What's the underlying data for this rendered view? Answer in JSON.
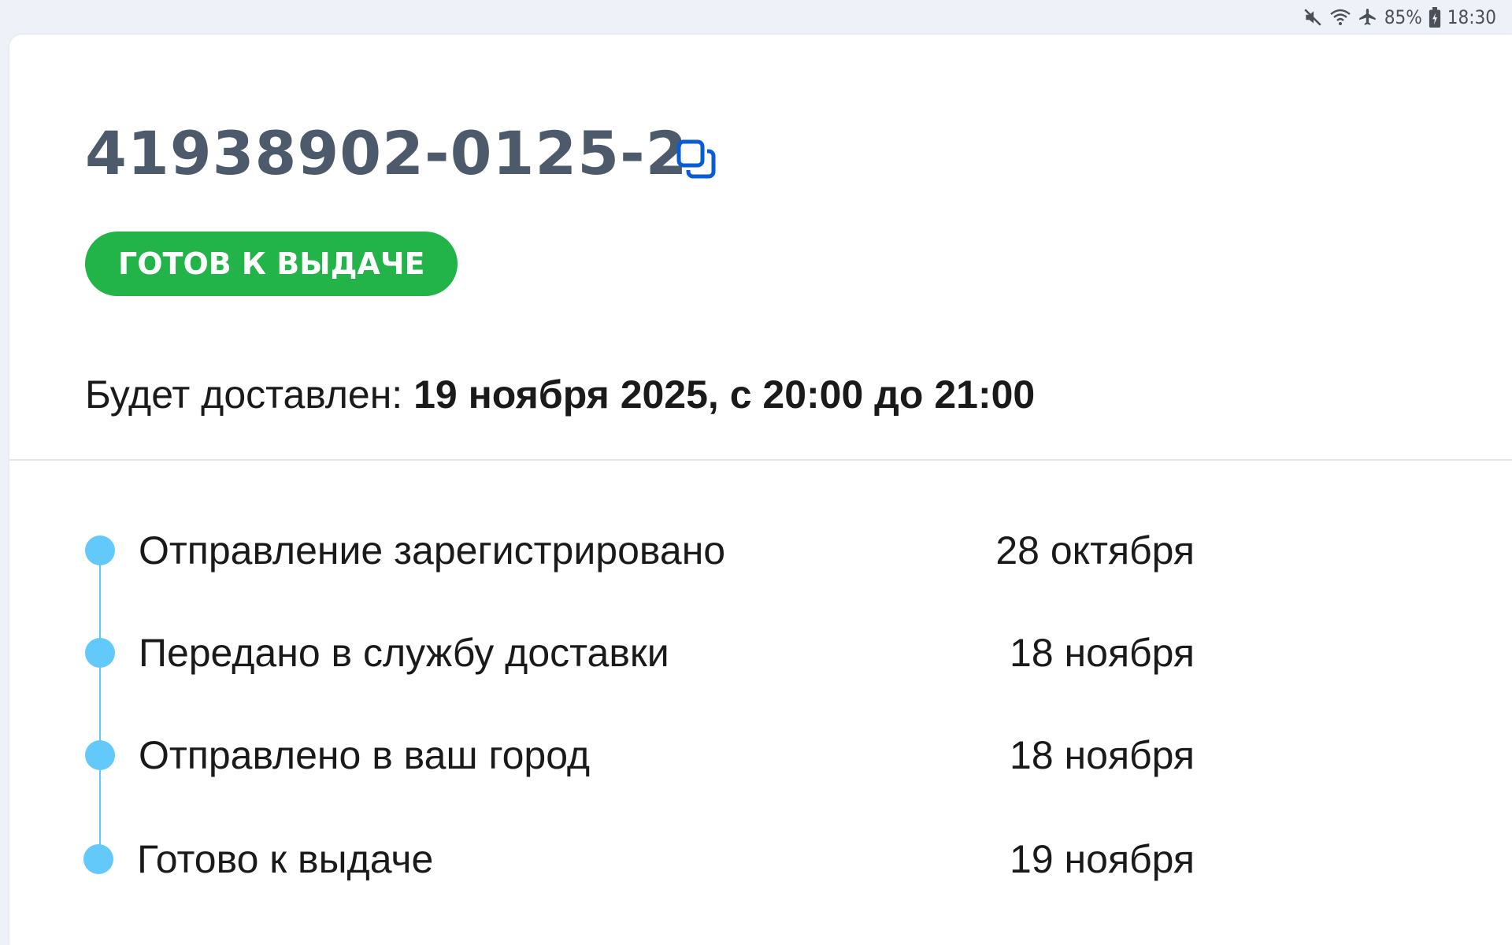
{
  "status_bar": {
    "icons": [
      "mute-icon",
      "wifi-icon",
      "airplane-mode-icon",
      "battery-icon"
    ],
    "battery": "85%",
    "time": "18:30"
  },
  "order": {
    "number": "41938902-0125-2",
    "copy_icon": "copy-icon",
    "status": "ГОТОВ К ВЫДАЧЕ",
    "status_color": "#22b349",
    "delivery_label": "Будет доставлен: ",
    "delivery_value": "19 ноября 2025, с 20:00 до 21:00"
  },
  "colors": {
    "accent": "#0a5bd6",
    "timeline": "#63c9fa",
    "number": "#4d5a6b"
  },
  "timeline": [
    {
      "label": "Отправление зарегистрировано",
      "date": "28 октября"
    },
    {
      "label": "Передано в службу доставки",
      "date": "18 ноября"
    },
    {
      "label": "Отправлено в ваш город",
      "date": "18 ноября"
    },
    {
      "label": "Готово к выдаче",
      "date": "19 ноября"
    }
  ]
}
